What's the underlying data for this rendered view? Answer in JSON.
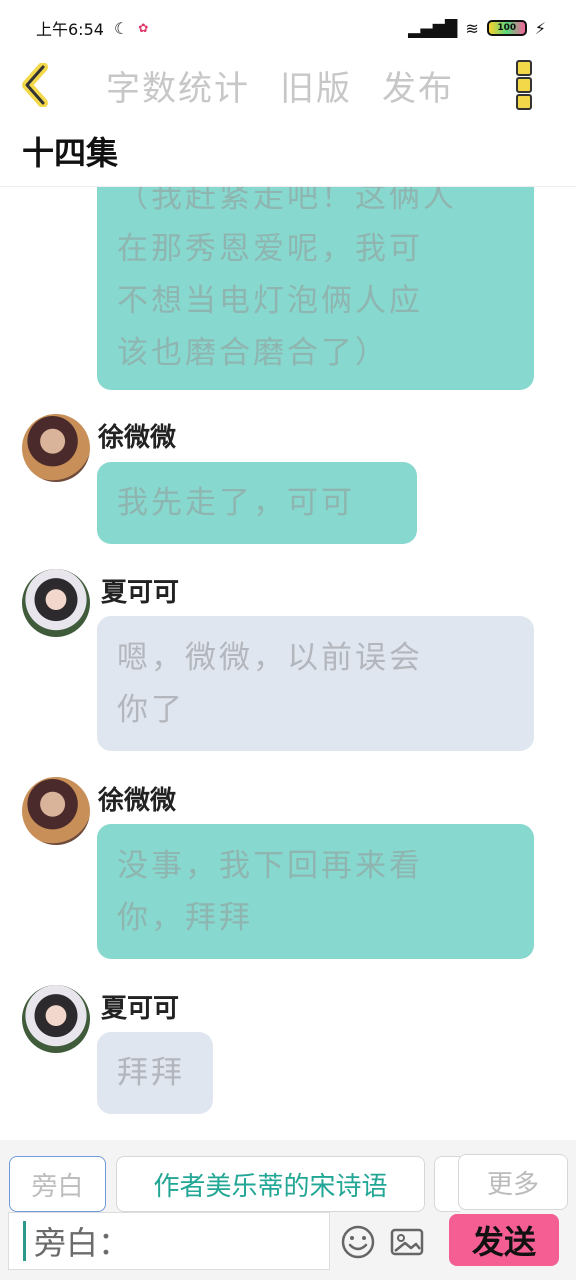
{
  "status": {
    "time": "上午6:54",
    "battery": "100"
  },
  "nav": {
    "items": [
      "字数统计",
      "旧版",
      "发布"
    ]
  },
  "chapter": "十四集",
  "messages": [
    {
      "speaker": "",
      "type": "teal",
      "lines": [
        "（我赶紧走吧！这俩人",
        "在那秀恩爱呢，我可",
        "不想当电灯泡俩人应",
        "该也磨合磨合了）"
      ]
    },
    {
      "speaker": "徐微微",
      "type": "teal",
      "lines": [
        "我先走了，可可"
      ]
    },
    {
      "speaker": "夏可可",
      "type": "grey",
      "lines": [
        "嗯，微微，以前误会",
        "你了"
      ]
    },
    {
      "speaker": "徐微微",
      "type": "teal",
      "lines": [
        "没事，我下回再来看",
        "你，拜拜"
      ]
    },
    {
      "speaker": "夏可可",
      "type": "grey",
      "lines": [
        "拜拜"
      ]
    }
  ],
  "composer": {
    "chip_narration": "旁白",
    "chip_author": "作者美乐蒂的宋诗语",
    "chip_more": "更多",
    "input_prefix": "旁白：",
    "send_label": "发送"
  },
  "colors": {
    "teal_bubble": "#87d8cf",
    "grey_bubble": "#e0e6ef",
    "send_button": "#f45e93",
    "nav_inactive": "#c7c7c7"
  }
}
